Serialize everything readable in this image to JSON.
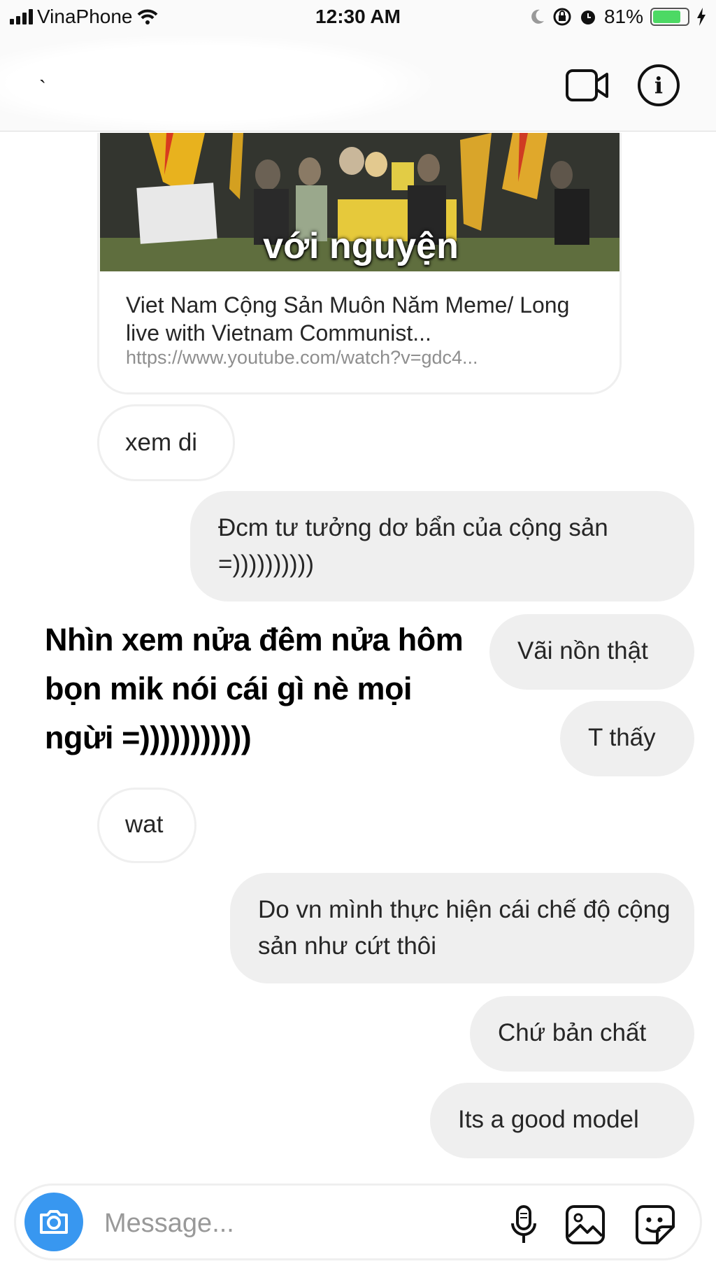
{
  "status_bar": {
    "carrier": "VinaPhone",
    "time": "12:30 AM",
    "battery_percent": "81%",
    "battery_level": 0.81
  },
  "header": {
    "back_glyph": "`",
    "video_icon": "video-camera-icon",
    "info_icon": "info-icon"
  },
  "link_card": {
    "thumbnail_caption": "với nguyện",
    "title": "Viet Nam Cộng Sản Muôn Năm Meme/ Long live with Vietnam Communist...",
    "url": "https://www.youtube.com/watch?v=gdc4..."
  },
  "messages": [
    {
      "side": "received",
      "text": "xem di"
    },
    {
      "side": "sent",
      "text": "Đcm tư tưởng dơ bẩn của cộng sản =))))))))))"
    },
    {
      "side": "sent",
      "text": "Vãi nồn thật"
    },
    {
      "side": "sent",
      "text": "T thấy"
    },
    {
      "side": "received",
      "text": "wat"
    },
    {
      "side": "sent",
      "text": "Do vn mình thực hiện cái chế độ cộng sản như cứt thôi"
    },
    {
      "side": "sent",
      "text": "Chứ bản chất"
    },
    {
      "side": "sent",
      "text": "Its a good model"
    }
  ],
  "overlay_caption": "Nhìn xem nửa đêm nửa hôm bọn mik nói cái gì nè mọi ngừi =)))))))))))",
  "composer": {
    "placeholder": "Message...",
    "icons": [
      "camera-icon",
      "microphone-icon",
      "gallery-icon",
      "sticker-icon"
    ]
  },
  "colors": {
    "accent": "#3897f0",
    "sent_bubble": "#efefef",
    "received_border": "#efefef",
    "battery": "#4cd964"
  }
}
